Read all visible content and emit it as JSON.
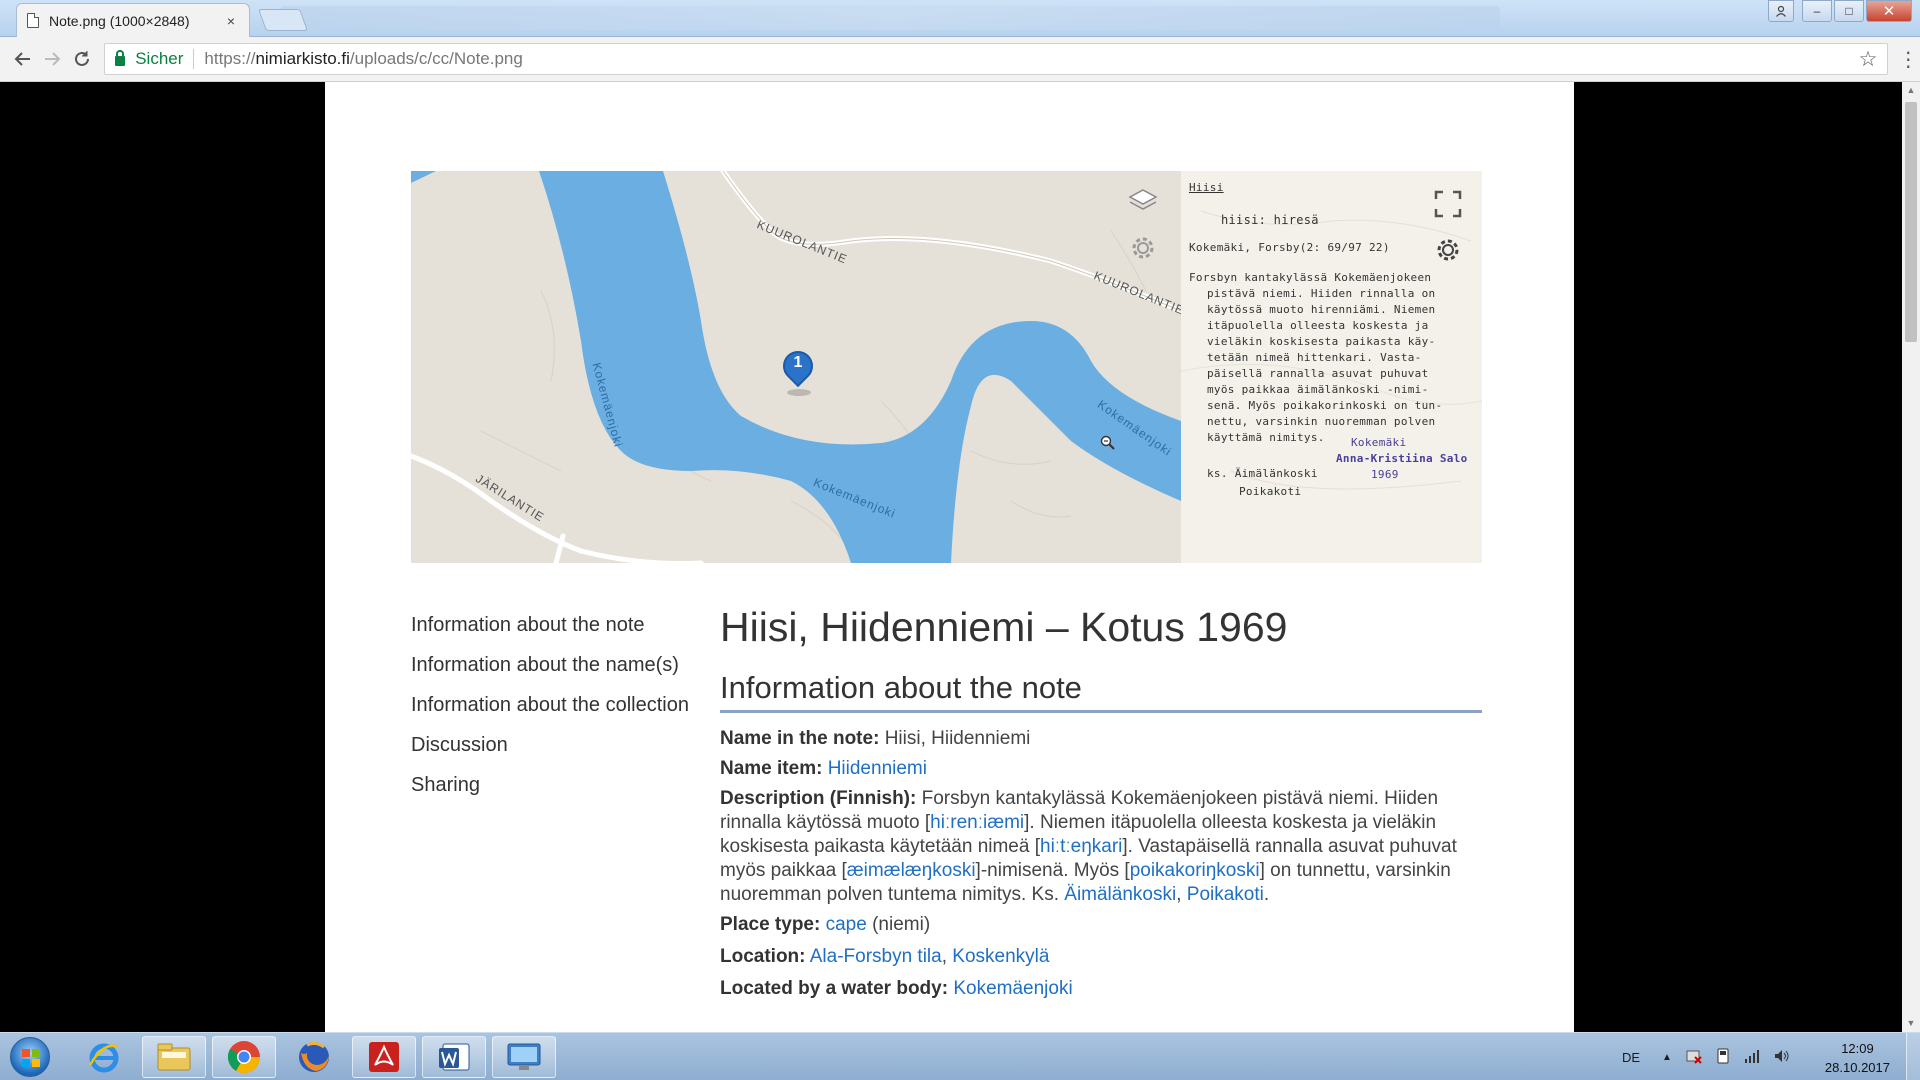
{
  "browser": {
    "tab_title": "Note.png (1000×2848)",
    "tab_close": "×",
    "secure_label": "Sicher",
    "url_scheme": "https://",
    "url_host": "nimiarkisto.fi",
    "url_path": "/uploads/c/cc/Note.png",
    "icons": [
      "back-arrow-icon",
      "forward-arrow-icon",
      "reload-icon",
      "lock-icon",
      "star-icon",
      "menu-dots-icon"
    ]
  },
  "window_controls": {
    "minimize": "–",
    "maximize": "□",
    "close": "✕"
  },
  "map": {
    "road_labels": [
      "KUUROLANTIE",
      "KUUROLANTIE",
      "JÄRILANTIE"
    ],
    "river_labels": [
      "Kokemäenjoki",
      "Kokemäenjoki",
      "Kokemäenjoki"
    ],
    "marker_number": "1",
    "icons": [
      "layers-icon",
      "settings-gear-icon",
      "fullscreen-icon",
      "settings-gear-icon"
    ],
    "colors": {
      "land": "#e6e1d8",
      "water": "#6aaee2",
      "marker": "#2a73c9"
    }
  },
  "note_card": {
    "lines": [
      "Hiisi",
      "hiisi: hiresä",
      "Kokemäki, Forsby(2: 69/97 22)",
      "Forsbyn kantakylässä Kokemäenjokeen",
      "pistävä niemi. Hiiden rinnalla on",
      "käytössä muoto hirenniämi. Niemen",
      "itäpuolella olleesta koskesta ja",
      "vieläkin koskisesta paikasta käy-",
      "tetään nimeä hittenkari. Vasta-",
      "päisellä rannalla asuvat puhuvat",
      "myös paikkaa äimälänkoski -nimi-",
      "senä. Myös poikakorinkoski on tun-",
      "nettu, varsinkin nuoremman polven",
      "käyttämä nimitys.",
      "ks. Äimälänkoski",
      "Poikakoti"
    ],
    "stamp_lines": [
      "Kokemäki",
      "Anna-Kristiina Salo",
      "1969"
    ]
  },
  "side_menu": [
    "Information about the note",
    "Information about the name(s)",
    "Information about the collection",
    "Discussion",
    "Sharing"
  ],
  "content": {
    "title": "Hiisi, Hiidenniemi – Kotus 1969",
    "section_heading": "Information about the note",
    "name_in_note_label": "Name in the note:",
    "name_in_note_value": "Hiisi, Hiidenniemi",
    "name_item_label": "Name item:",
    "name_item_link": "Hiidenniemi",
    "description_label": "Description (Finnish):",
    "description_parts": {
      "p1": "Forsbyn kantakylässä Kokemäenjokeen pistävä niemi. Hiiden rinnalla käytössä muoto [",
      "l1": "hiːrenːiæmi",
      "p2": "]. Niemen itäpuolella olleesta koskesta ja vieläkin koskisesta paikasta käytetään nimeä [",
      "l2": "hiːtːeŋkari",
      "p3": "]. Vastapäisellä rannalla asuvat puhuvat myös paikkaa [",
      "l3": "æimælæŋkoski",
      "p4": "]-nimisenä. Myös [",
      "l4": "poikakoriŋkoski",
      "p5": "] on tunnettu, varsinkin nuoremman polven tuntema nimitys. Ks. ",
      "l5": "Äimälänkoski",
      "p6": ", ",
      "l6": "Poikakoti",
      "p7": "."
    },
    "place_type_label": "Place type:",
    "place_type_link": "cape",
    "place_type_extra": " (niemi)",
    "location_label": "Location:",
    "location_link1": "Ala-Forsbyn tila",
    "location_sep": ", ",
    "location_link2": "Koskenkylä",
    "water_body_label": "Located by a water body:",
    "water_body_link": "Kokemäenjoki"
  },
  "taskbar": {
    "apps": [
      "windows-start-icon",
      "internet-explorer-icon",
      "file-explorer-icon",
      "chrome-icon",
      "firefox-icon",
      "acrobat-icon",
      "word-icon",
      "remote-desktop-icon"
    ],
    "language": "DE",
    "time": "12:09",
    "date": "28.10.2017"
  }
}
